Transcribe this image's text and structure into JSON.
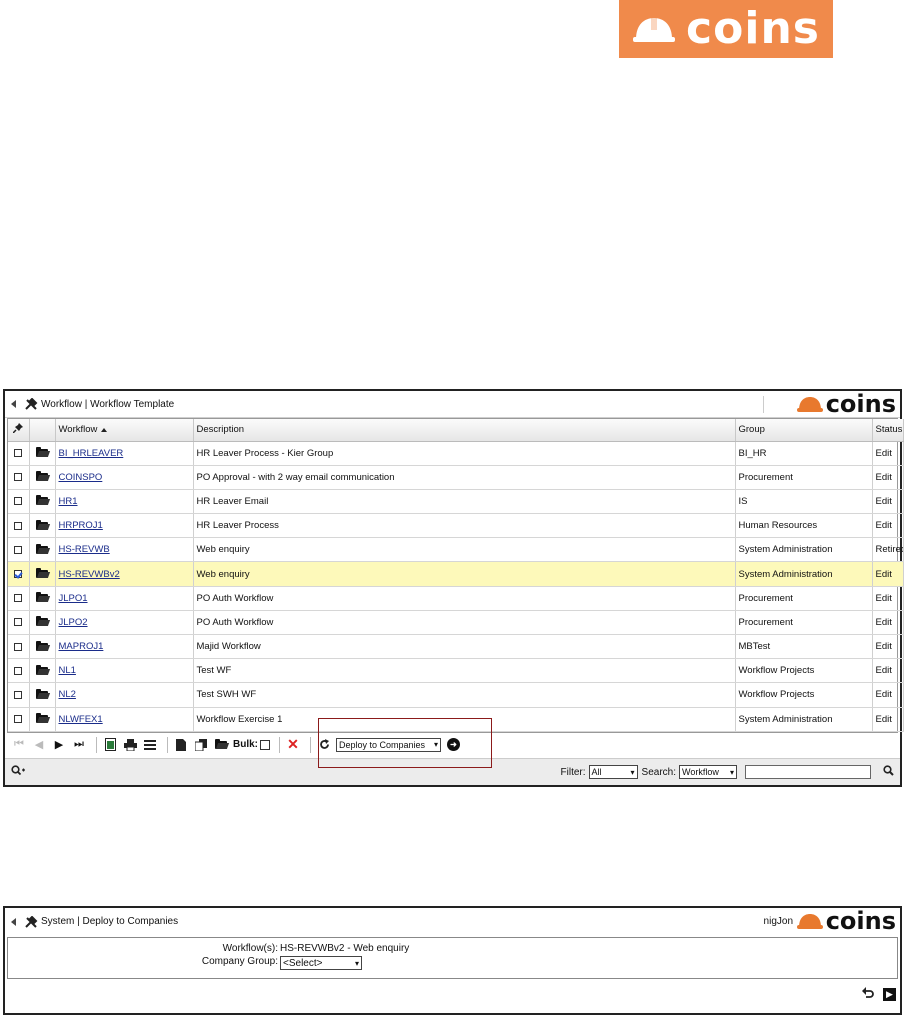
{
  "brand": {
    "logo_text": "coins"
  },
  "window1": {
    "title": "Workflow | Workflow Template",
    "columns": {
      "workflow": "Workflow",
      "description": "Description",
      "group": "Group",
      "status": "Status"
    },
    "rows": [
      {
        "code": "BI_HRLEAVER",
        "description": "HR Leaver Process - Kier Group",
        "group": "BI_HR",
        "status": "Edit",
        "checked": false
      },
      {
        "code": "COINSPO",
        "description": "PO Approval - with 2 way email communication",
        "group": "Procurement",
        "status": "Edit",
        "checked": false
      },
      {
        "code": "HR1",
        "description": "HR Leaver Email",
        "group": "IS",
        "status": "Edit",
        "checked": false
      },
      {
        "code": "HRPROJ1",
        "description": "HR Leaver Process",
        "group": "Human Resources",
        "status": "Edit",
        "checked": false
      },
      {
        "code": "HS-REVWB",
        "description": "Web enquiry",
        "group": "System Administration",
        "status": "Retired",
        "checked": false
      },
      {
        "code": "HS-REVWBv2",
        "description": "Web enquiry",
        "group": "System Administration",
        "status": "Edit",
        "checked": true
      },
      {
        "code": "JLPO1",
        "description": "PO Auth Workflow",
        "group": "Procurement",
        "status": "Edit",
        "checked": false
      },
      {
        "code": "JLPO2",
        "description": "PO Auth Workflow",
        "group": "Procurement",
        "status": "Edit",
        "checked": false
      },
      {
        "code": "MAPROJ1",
        "description": "Majid Workflow",
        "group": "MBTest",
        "status": "Edit",
        "checked": false
      },
      {
        "code": "NL1",
        "description": "Test WF",
        "group": "Workflow Projects",
        "status": "Edit",
        "checked": false
      },
      {
        "code": "NL2",
        "description": "Test SWH WF",
        "group": "Workflow Projects",
        "status": "Edit",
        "checked": false
      },
      {
        "code": "NLWFEX1",
        "description": "Workflow Exercise 1",
        "group": "System Administration",
        "status": "Edit",
        "checked": false
      }
    ],
    "toolbar": {
      "bulk_label": "Bulk:",
      "action_select": "Deploy to Companies"
    },
    "footer": {
      "filter_label": "Filter:",
      "filter_value": "All",
      "search_label": "Search:",
      "search_value": "Workflow",
      "search_text": ""
    }
  },
  "window2": {
    "title": "System | Deploy to Companies",
    "user": "nigJon",
    "workflows_label": "Workflow(s):",
    "workflows_value": "HS-REVWBv2 - Web enquiry",
    "company_group_label": "Company Group:",
    "company_group_value": "<Select>"
  },
  "colors": {
    "brand_orange": "#f08a4b",
    "selected_row": "#fdf9ba",
    "highlight_box": "#8b1a1a"
  }
}
